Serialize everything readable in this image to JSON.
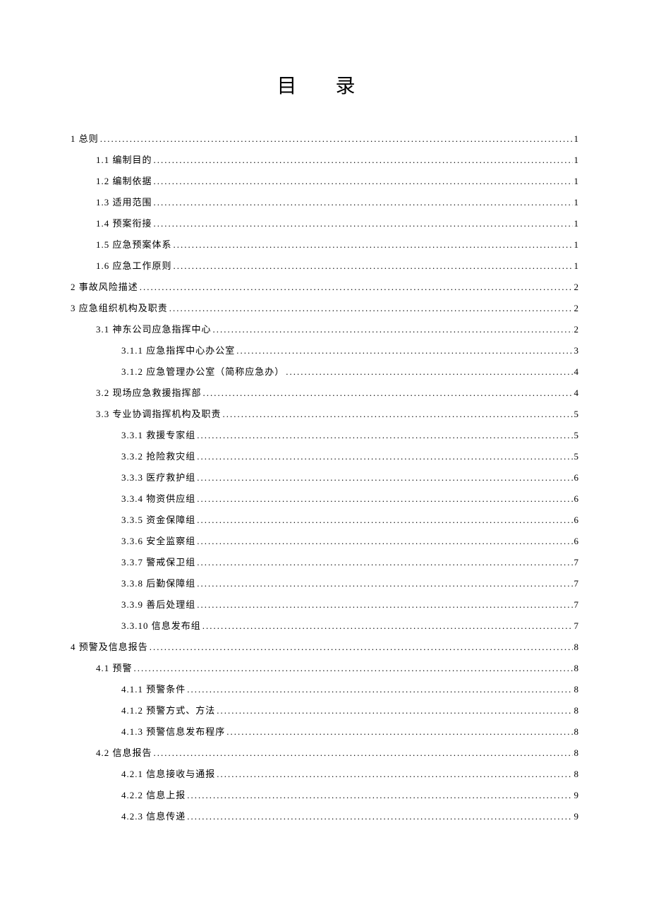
{
  "title": "目 录",
  "toc": [
    {
      "level": 1,
      "label": "1 总则",
      "page": "1"
    },
    {
      "level": 2,
      "label": "1.1 编制目的",
      "page": "1"
    },
    {
      "level": 2,
      "label": "1.2 编制依据",
      "page": "1"
    },
    {
      "level": 2,
      "label": "1.3 适用范围",
      "page": "1"
    },
    {
      "level": 2,
      "label": "1.4 预案衔接",
      "page": "1"
    },
    {
      "level": 2,
      "label": "1.5 应急预案体系",
      "page": "1"
    },
    {
      "level": 2,
      "label": "1.6 应急工作原则",
      "page": "1"
    },
    {
      "level": 1,
      "label": "2 事故风险描述",
      "page": "2"
    },
    {
      "level": 1,
      "label": "3 应急组织机构及职责",
      "page": "2"
    },
    {
      "level": 2,
      "label": "3.1 神东公司应急指挥中心",
      "page": "2"
    },
    {
      "level": 3,
      "label": "3.1.1 应急指挥中心办公室",
      "page": "3"
    },
    {
      "level": 3,
      "label": "3.1.2 应急管理办公室（简称应急办）",
      "page": "4"
    },
    {
      "level": 2,
      "label": "3.2 现场应急救援指挥部",
      "page": "4"
    },
    {
      "level": 2,
      "label": "3.3 专业协调指挥机构及职责",
      "page": "5"
    },
    {
      "level": 3,
      "label": "3.3.1 救援专家组",
      "page": "5"
    },
    {
      "level": 3,
      "label": "3.3.2 抢险救灾组",
      "page": "5"
    },
    {
      "level": 3,
      "label": "3.3.3 医疗救护组",
      "page": "6"
    },
    {
      "level": 3,
      "label": "3.3.4 物资供应组",
      "page": "6"
    },
    {
      "level": 3,
      "label": "3.3.5 资金保障组",
      "page": "6"
    },
    {
      "level": 3,
      "label": "3.3.6 安全监察组",
      "page": "6"
    },
    {
      "level": 3,
      "label": "3.3.7 警戒保卫组",
      "page": "7"
    },
    {
      "level": 3,
      "label": "3.3.8 后勤保障组",
      "page": "7"
    },
    {
      "level": 3,
      "label": "3.3.9 善后处理组",
      "page": "7"
    },
    {
      "level": 3,
      "label": "3.3.10 信息发布组",
      "page": "7"
    },
    {
      "level": 1,
      "label": "4 预警及信息报告",
      "page": "8"
    },
    {
      "level": 2,
      "label": "4.1 预警",
      "page": "8"
    },
    {
      "level": 3,
      "label": "4.1.1 预警条件",
      "page": "8"
    },
    {
      "level": 3,
      "label": "4.1.2 预警方式、方法",
      "page": "8"
    },
    {
      "level": 3,
      "label": "4.1.3 预警信息发布程序",
      "page": "8"
    },
    {
      "level": 2,
      "label": "4.2 信息报告",
      "page": "8"
    },
    {
      "level": 3,
      "label": "4.2.1 信息接收与通报",
      "page": "8"
    },
    {
      "level": 3,
      "label": "4.2.2 信息上报",
      "page": "9"
    },
    {
      "level": 3,
      "label": "4.2.3 信息传递",
      "page": "9"
    }
  ]
}
